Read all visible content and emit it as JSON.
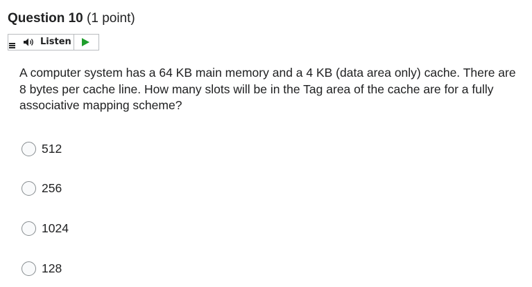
{
  "question": {
    "title": "Question 10",
    "points": "(1 point)",
    "text": "A computer system has a 64 KB main memory and a 4 KB (data area only) cache. There are 8 bytes per cache line. How many slots will be in the Tag area of the cache are for a fully associative mapping scheme?"
  },
  "listen": {
    "label": "Listen",
    "menu_icon": "menu-icon",
    "speaker_icon": "speaker-icon",
    "play_icon": "play-icon",
    "play_color": "#1f9e2c"
  },
  "options": [
    {
      "label": "512"
    },
    {
      "label": "256"
    },
    {
      "label": "1024"
    },
    {
      "label": "128"
    }
  ]
}
